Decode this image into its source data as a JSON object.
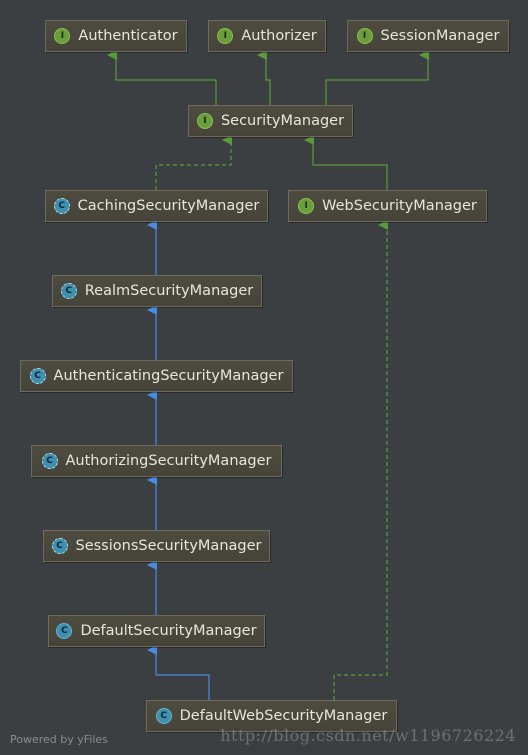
{
  "colors": {
    "background": "#3c3f41",
    "implements_edge": "#5a9a3a",
    "extends_edge": "#4a8ae0"
  },
  "nodes": {
    "authenticator": {
      "label": "Authenticator",
      "badge": "I",
      "kind": "interface"
    },
    "authorizer": {
      "label": "Authorizer",
      "badge": "I",
      "kind": "interface"
    },
    "session_manager": {
      "label": "SessionManager",
      "badge": "I",
      "kind": "interface"
    },
    "security_manager": {
      "label": "SecurityManager",
      "badge": "I",
      "kind": "interface"
    },
    "caching_security_manager": {
      "label": "CachingSecurityManager",
      "badge": "C",
      "kind": "abstract-class"
    },
    "web_security_manager": {
      "label": "WebSecurityManager",
      "badge": "I",
      "kind": "interface"
    },
    "realm_security_manager": {
      "label": "RealmSecurityManager",
      "badge": "C",
      "kind": "abstract-class"
    },
    "authenticating_security_manager": {
      "label": "AuthenticatingSecurityManager",
      "badge": "C",
      "kind": "abstract-class"
    },
    "authorizing_security_manager": {
      "label": "AuthorizingSecurityManager",
      "badge": "C",
      "kind": "abstract-class"
    },
    "sessions_security_manager": {
      "label": "SessionsSecurityManager",
      "badge": "C",
      "kind": "abstract-class"
    },
    "default_security_manager": {
      "label": "DefaultSecurityManager",
      "badge": "C",
      "kind": "class"
    },
    "default_web_security_manager": {
      "label": "DefaultWebSecurityManager",
      "badge": "C",
      "kind": "class"
    }
  },
  "edges": [
    {
      "from": "security_manager",
      "to": "authenticator",
      "type": "extends-interface"
    },
    {
      "from": "security_manager",
      "to": "authorizer",
      "type": "extends-interface"
    },
    {
      "from": "security_manager",
      "to": "session_manager",
      "type": "extends-interface"
    },
    {
      "from": "caching_security_manager",
      "to": "security_manager",
      "type": "implements"
    },
    {
      "from": "web_security_manager",
      "to": "security_manager",
      "type": "extends-interface"
    },
    {
      "from": "realm_security_manager",
      "to": "caching_security_manager",
      "type": "extends"
    },
    {
      "from": "authenticating_security_manager",
      "to": "realm_security_manager",
      "type": "extends"
    },
    {
      "from": "authorizing_security_manager",
      "to": "authenticating_security_manager",
      "type": "extends"
    },
    {
      "from": "sessions_security_manager",
      "to": "authorizing_security_manager",
      "type": "extends"
    },
    {
      "from": "default_security_manager",
      "to": "sessions_security_manager",
      "type": "extends"
    },
    {
      "from": "default_web_security_manager",
      "to": "default_security_manager",
      "type": "extends"
    },
    {
      "from": "default_web_security_manager",
      "to": "web_security_manager",
      "type": "implements"
    }
  ],
  "footer": "Powered by yFiles",
  "watermark": "http://blog.csdn.net/w1196726224"
}
